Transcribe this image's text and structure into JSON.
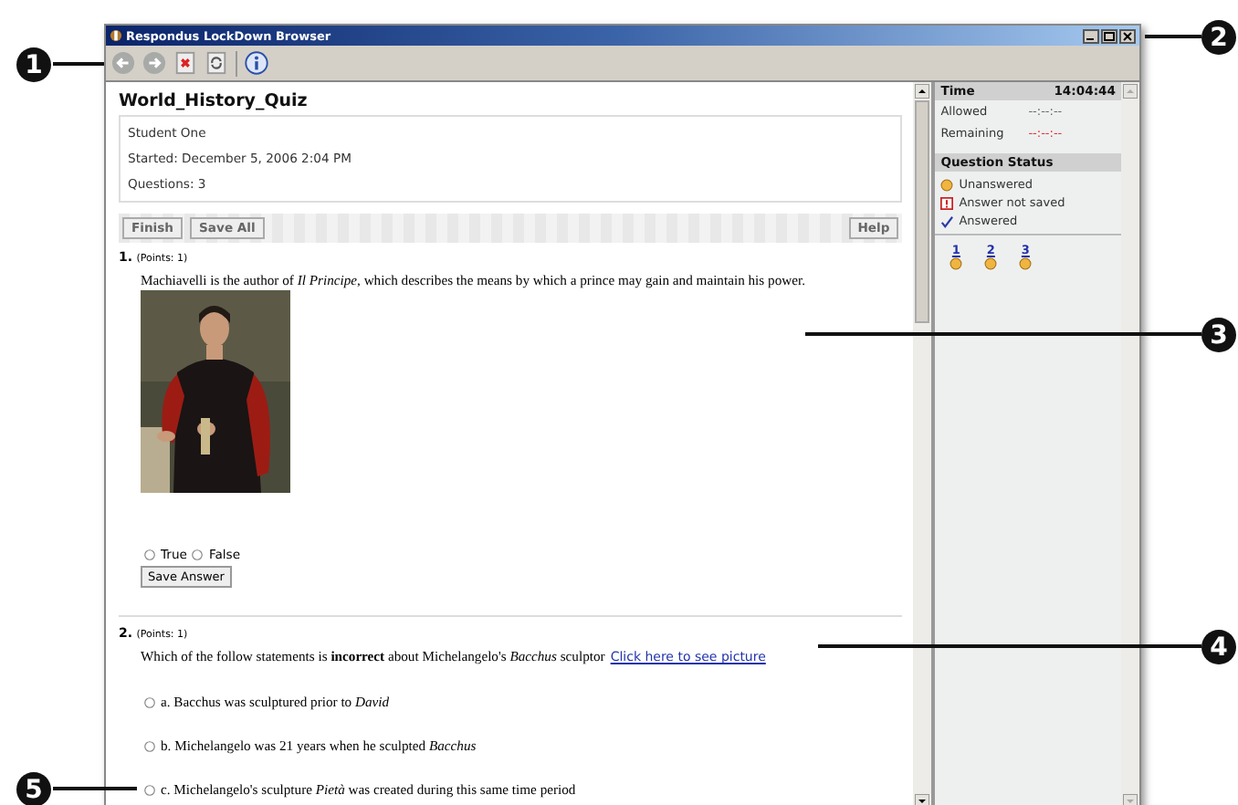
{
  "window": {
    "title": "Respondus LockDown Browser"
  },
  "callouts": [
    {
      "number": "1"
    },
    {
      "number": "2"
    },
    {
      "number": "3"
    },
    {
      "number": "4"
    },
    {
      "number": "5"
    }
  ],
  "quiz": {
    "name": "World_History_Quiz",
    "info": [
      "Student One",
      "Started: December 5, 2006 2:04 PM",
      "Questions: 3"
    ],
    "buttons": [
      "Finish",
      "Save All"
    ],
    "help": "Help"
  },
  "questions": [
    {
      "number": "1.",
      "points": "(Points: 1)",
      "text": "Machiavelli is the author of *Il Principe*, which describes the means by which a prince may gain and maintain his power.",
      "image": {
        "kind": "picture"
      },
      "kind": "inline",
      "options": [
        {
          "label": "True",
          "selected": false
        },
        {
          "label": "False",
          "selected": false
        }
      ],
      "save": "Save Answer"
    },
    {
      "number": "2.",
      "points": "(Points: 1)",
      "text": "Which of the follow statements is **incorrect** about Michelangelo's *Bacchus* sculptor",
      "link": "Click here to see picture",
      "kind": "stacked",
      "options": [
        {
          "label": "a. Bacchus was sculptured prior to *David*",
          "selected": false
        },
        {
          "label": "b. Michelangelo was 21 years when he sculpted *Bacchus*",
          "selected": false
        },
        {
          "label": "c. Michelangelo's sculpture *Pietà* was created during this same time period",
          "selected": false
        }
      ]
    }
  ],
  "sidebar": {
    "time_label": "Time",
    "clock": "14:04:44",
    "rows": [
      {
        "label": "Allowed",
        "value": "--:--:--",
        "alert": false
      },
      {
        "label": "Remaining",
        "value": "--:--:--",
        "alert": true
      }
    ],
    "status_title": "Question Status",
    "legend": [
      {
        "kind": "dot",
        "label": "Unanswered"
      },
      {
        "kind": "alert",
        "label": "Answer not saved"
      },
      {
        "kind": "check",
        "label": "Answered"
      }
    ],
    "questions": [
      {
        "label": "1",
        "kind": "unanswered"
      },
      {
        "label": "2",
        "kind": "unanswered"
      },
      {
        "label": "3",
        "kind": "unanswered"
      }
    ]
  }
}
